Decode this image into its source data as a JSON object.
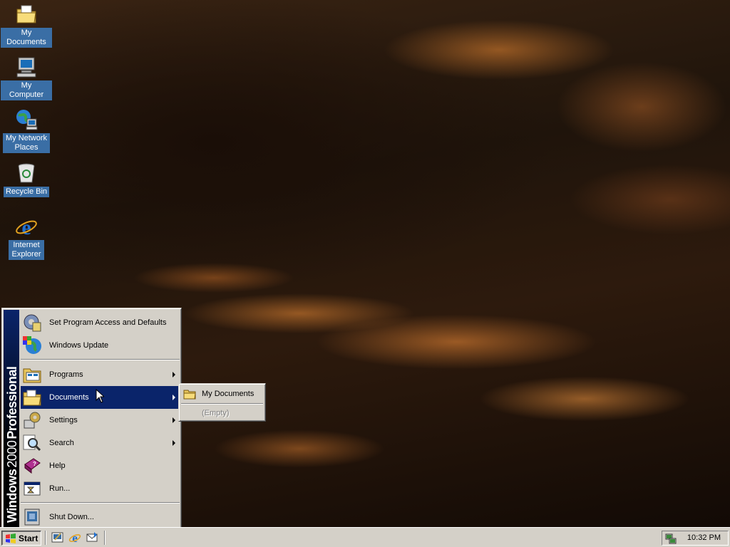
{
  "desktop": {
    "icons": [
      {
        "label": "My Documents",
        "icon": "my-documents-icon"
      },
      {
        "label": "My Computer",
        "icon": "my-computer-icon"
      },
      {
        "label": "My Network Places",
        "icon": "my-network-places-icon"
      },
      {
        "label": "Recycle Bin",
        "icon": "recycle-bin-icon"
      },
      {
        "label": "Internet Explorer",
        "icon": "internet-explorer-icon"
      }
    ],
    "wallpaper": "orange fire clouds"
  },
  "start_menu": {
    "banner": {
      "brand": "Windows",
      "version": "2000",
      "edition": "Professional"
    },
    "top_items": [
      {
        "label": "Set Program Access and Defaults",
        "icon": "program-access-icon"
      },
      {
        "label": "Windows Update",
        "icon": "windows-update-icon"
      }
    ],
    "items": [
      {
        "label": "Programs",
        "icon": "programs-icon",
        "submenu": true
      },
      {
        "label": "Documents",
        "icon": "documents-icon",
        "submenu": true,
        "selected": true
      },
      {
        "label": "Settings",
        "icon": "settings-icon",
        "submenu": true
      },
      {
        "label": "Search",
        "icon": "search-icon",
        "submenu": true
      },
      {
        "label": "Help",
        "icon": "help-icon",
        "submenu": false
      },
      {
        "label": "Run...",
        "icon": "run-icon",
        "submenu": false
      }
    ],
    "shutdown": {
      "label": "Shut Down...",
      "icon": "shutdown-icon"
    }
  },
  "documents_submenu": {
    "items": [
      {
        "label": "My Documents",
        "icon": "folder-icon"
      }
    ],
    "empty_label": "(Empty)"
  },
  "taskbar": {
    "start_label": "Start",
    "quick_launch": [
      "show-desktop-icon",
      "internet-explorer-icon",
      "outlook-express-icon"
    ],
    "clock": "10:32 PM"
  },
  "colors": {
    "menu_face": "#d4d0c8",
    "selection": "#0a246a",
    "desktop_label_bg": "#3a6ea5"
  }
}
